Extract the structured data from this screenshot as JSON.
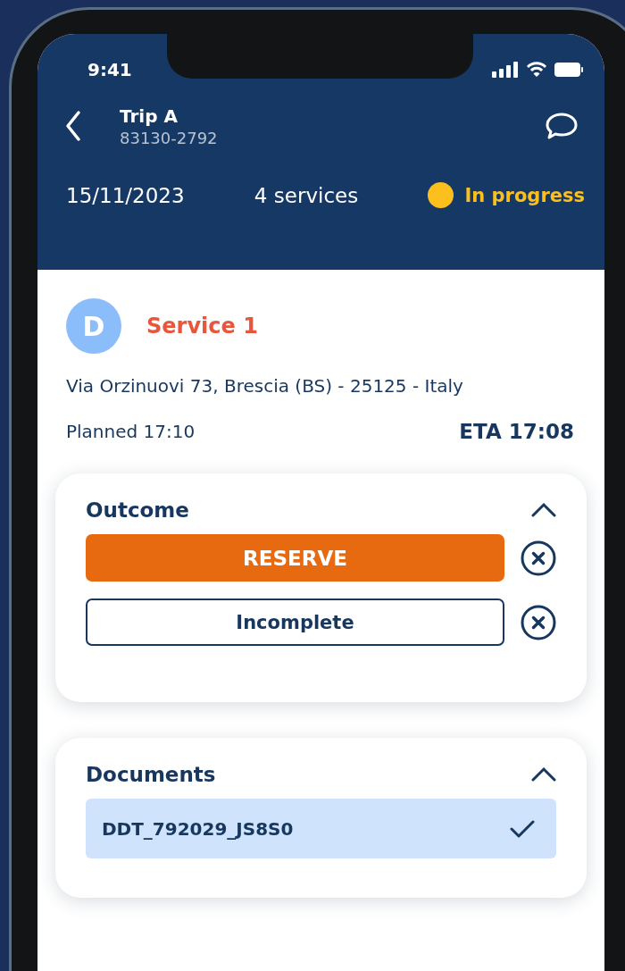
{
  "status_bar": {
    "time": "9:41"
  },
  "header": {
    "title": "Trip A",
    "subtitle": "83130-2792"
  },
  "summary": {
    "date": "15/11/2023",
    "services": "4 services",
    "status": {
      "label": "In progress",
      "color": "#fbbf1e"
    }
  },
  "service": {
    "avatar": "D",
    "title": "Service 1",
    "address": "Via Orzinuovi 73, Brescia (BS) - 25125 - Italy",
    "planned": "Planned 17:10",
    "eta": "ETA 17:08"
  },
  "outcome": {
    "title": "Outcome",
    "expanded": true,
    "options": [
      {
        "label": "RESERVE",
        "selected": true
      },
      {
        "label": "Incomplete",
        "selected": false
      }
    ]
  },
  "documents": {
    "title": "Documents",
    "expanded": true,
    "items": [
      {
        "name": "DDT_792029_JS8S0",
        "checked": true
      }
    ]
  }
}
